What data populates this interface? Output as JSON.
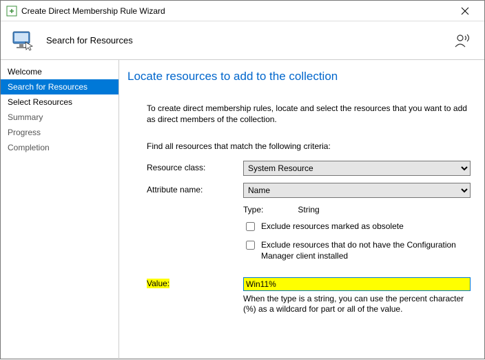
{
  "window": {
    "title": "Create Direct Membership Rule Wizard"
  },
  "header": {
    "title": "Search for Resources"
  },
  "sidebar": {
    "items": [
      {
        "label": "Welcome",
        "selected": false,
        "dim": false
      },
      {
        "label": "Search for Resources",
        "selected": true,
        "dim": false
      },
      {
        "label": "Select Resources",
        "selected": false,
        "dim": false
      },
      {
        "label": "Summary",
        "selected": false,
        "dim": true
      },
      {
        "label": "Progress",
        "selected": false,
        "dim": true
      },
      {
        "label": "Completion",
        "selected": false,
        "dim": true
      }
    ]
  },
  "main": {
    "page_title": "Locate resources to add to the collection",
    "intro": "To create direct membership rules, locate and select the resources that you want to add as direct members of the collection.",
    "criteria_label": "Find all resources that match the following criteria:",
    "resource_class": {
      "label": "Resource class:",
      "value": "System Resource"
    },
    "attribute_name": {
      "label": "Attribute name:",
      "value": "Name"
    },
    "type_label": "Type:",
    "type_value": "String",
    "exclude_obsolete": {
      "label": "Exclude resources marked as obsolete",
      "checked": false
    },
    "exclude_noclient": {
      "label": "Exclude resources that do not have the Configuration Manager client installed",
      "checked": false
    },
    "value": {
      "label": "Value:",
      "value": "Win11%"
    },
    "hint": "When the type is a string, you can use the percent character (%) as a wildcard for part or all of the value."
  }
}
